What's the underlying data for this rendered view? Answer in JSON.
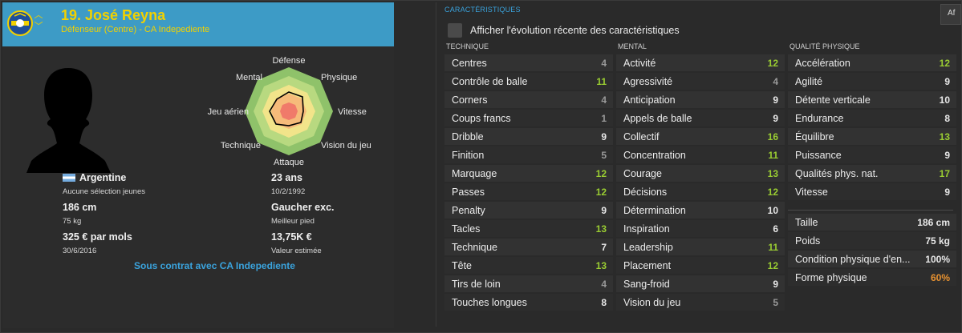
{
  "colors": {
    "accent": "#3d9bc6",
    "name_yellow": "#f2d100",
    "link_blue": "#3aa3dd",
    "green": "#9acd32",
    "orange": "#e89230",
    "grey": "#9a9a9a"
  },
  "player": {
    "name": "19. José Reyna",
    "role": "Défenseur (Centre) - CA Indepediente",
    "nationality": "Argentine",
    "youth_caps": "Aucune sélection jeunes",
    "height": "186 cm",
    "weight": "75 kg",
    "wage": "325 € par mols",
    "contract_end": "30/6/2016",
    "age": "23 ans",
    "dob": "10/2/1992",
    "foot": "Gaucher exc.",
    "foot_label": "Meilleur pied",
    "value": "13,75K €",
    "value_label": "Valeur estimée",
    "contract_link": "Sous contrat avec CA Indepediente"
  },
  "radar": {
    "labels": {
      "defense": "Défense",
      "physique": "Physique",
      "vitesse": "Vitesse",
      "vision": "Vision du jeu",
      "attaque": "Attaque",
      "technique": "Technique",
      "jeu_aerien": "Jeu aérien",
      "mental": "Mental"
    }
  },
  "attributes": {
    "section_title": "CARACTÉRISTIQUES",
    "af_button": "Af",
    "toggle_label": "Afficher l'évolution récente des caractéristiques",
    "technique_header": "TECHNIQUE",
    "mental_header": "MENTAL",
    "physical_header": "QUALITÉ PHYSIQUE",
    "technique": [
      {
        "name": "Centres",
        "value": "4"
      },
      {
        "name": "Contrôle de balle",
        "value": "11"
      },
      {
        "name": "Corners",
        "value": "4"
      },
      {
        "name": "Coups francs",
        "value": "1"
      },
      {
        "name": "Dribble",
        "value": "9"
      },
      {
        "name": "Finition",
        "value": "5"
      },
      {
        "name": "Marquage",
        "value": "12"
      },
      {
        "name": "Passes",
        "value": "12"
      },
      {
        "name": "Penalty",
        "value": "9"
      },
      {
        "name": "Tacles",
        "value": "13"
      },
      {
        "name": "Technique",
        "value": "7"
      },
      {
        "name": "Tête",
        "value": "13"
      },
      {
        "name": "Tirs de loin",
        "value": "4"
      },
      {
        "name": "Touches longues",
        "value": "8"
      }
    ],
    "mental": [
      {
        "name": "Activité",
        "value": "12"
      },
      {
        "name": "Agressivité",
        "value": "4"
      },
      {
        "name": "Anticipation",
        "value": "9"
      },
      {
        "name": "Appels de balle",
        "value": "9"
      },
      {
        "name": "Collectif",
        "value": "16"
      },
      {
        "name": "Concentration",
        "value": "11"
      },
      {
        "name": "Courage",
        "value": "13"
      },
      {
        "name": "Décisions",
        "value": "12"
      },
      {
        "name": "Détermination",
        "value": "10"
      },
      {
        "name": "Inspiration",
        "value": "6"
      },
      {
        "name": "Leadership",
        "value": "11"
      },
      {
        "name": "Placement",
        "value": "12"
      },
      {
        "name": "Sang-froid",
        "value": "9"
      },
      {
        "name": "Vision du jeu",
        "value": "5"
      }
    ],
    "physical": [
      {
        "name": "Accélération",
        "value": "12"
      },
      {
        "name": "Agilité",
        "value": "9"
      },
      {
        "name": "Détente verticale",
        "value": "10"
      },
      {
        "name": "Endurance",
        "value": "8"
      },
      {
        "name": "Équilibre",
        "value": "13"
      },
      {
        "name": "Puissance",
        "value": "9"
      },
      {
        "name": "Qualités phys. nat.",
        "value": "17"
      },
      {
        "name": "Vitesse",
        "value": "9"
      }
    ],
    "physical_info": [
      {
        "name": "Taille",
        "value": "186 cm"
      },
      {
        "name": "Poids",
        "value": "75 kg"
      },
      {
        "name": "Condition physique d'en...",
        "value": "100%"
      },
      {
        "name": "Forme physique",
        "value": "60%"
      }
    ]
  }
}
